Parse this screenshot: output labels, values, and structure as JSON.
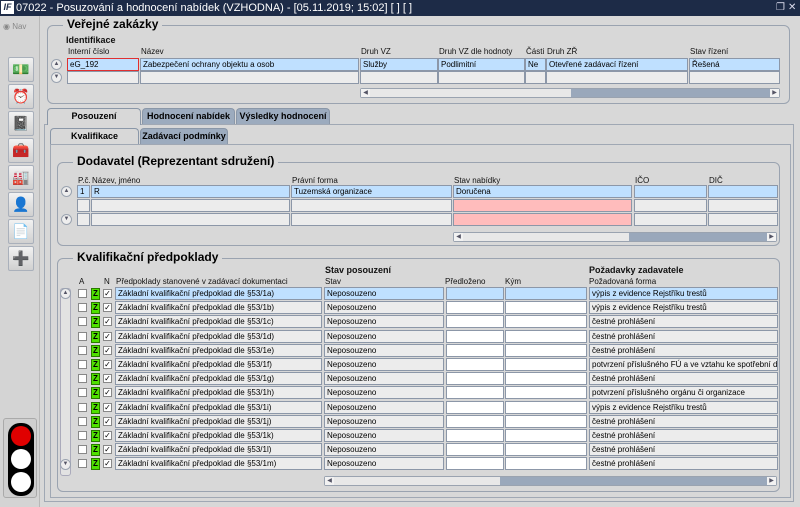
{
  "window": {
    "title": "07022 - Posuzování a hodnocení nabídek (VZHODNA) - [05.11.2019; 15:02]  [ ]  [ ]",
    "logo": "IF",
    "restore_icon": "restore-icon",
    "close_icon": "close-icon"
  },
  "sidebar": {
    "nav_label": "Nav",
    "icons": [
      "money-icon",
      "alarm-clock-icon",
      "notebook-icon",
      "toolbox-icon",
      "factory-icon",
      "person-icon",
      "document-icon",
      "new-document-icon"
    ],
    "traffic_light": {
      "red": "#e00000",
      "active": "red"
    }
  },
  "zakazky": {
    "title": "Veřejné zakázky",
    "section": "Identifikace",
    "columns": [
      "Interní číslo",
      "Název",
      "Druh VZ",
      "Druh VZ dle hodnoty",
      "Části",
      "Druh ZŘ",
      "Stav řízení"
    ],
    "row": [
      "eG_192",
      "Zabezpečení ochrany objektu a osob",
      "Služby",
      "Podlimitní",
      "Ne",
      "Otevřené zadávací řízení",
      "Řešená"
    ]
  },
  "tabs": [
    {
      "label": "Posouzení",
      "active": true
    },
    {
      "label": "Hodnocení nabídek"
    },
    {
      "label": "Výsledky hodnocení"
    }
  ],
  "subtabs": [
    {
      "label": "Kvalifikace",
      "active": true
    },
    {
      "label": "Zadávací podmínky"
    }
  ],
  "dodavatel": {
    "title": "Dodavatel (Reprezentant sdružení)",
    "columns": [
      "P.č.",
      "Název, jméno",
      "Právní forma",
      "Stav nabídky",
      "IČO",
      "DIČ"
    ],
    "rows": [
      [
        "1",
        "R",
        "Tuzemská organizace",
        "Doručena",
        "",
        ""
      ],
      [
        "",
        "",
        "",
        "",
        "",
        ""
      ],
      [
        "",
        "",
        "",
        "",
        "",
        ""
      ]
    ]
  },
  "kvalifikace": {
    "title": "Kvalifikační předpoklady",
    "group_stav": "Stav posouzení",
    "group_pozadavky": "Požadavky zadavatele",
    "columns": {
      "a": "A",
      "n": "N",
      "predpoklady": "Předpoklady stanovené v zadávací dokumentaci",
      "stav": "Stav",
      "predlozeno": "Předloženo",
      "kym": "Kým",
      "forma": "Požadovaná forma"
    },
    "z_label": "Z",
    "z_color": "#4fe000",
    "rows": [
      {
        "a": false,
        "n": true,
        "predpoklad": "Základní kvalifikační předpoklad dle §53/1a)",
        "stav": "Neposouzeno",
        "forma": "výpis z evidence Rejstříku trestů"
      },
      {
        "a": false,
        "n": true,
        "predpoklad": "Základní kvalifikační předpoklad dle §53/1b)",
        "stav": "Neposouzeno",
        "forma": "výpis z evidence Rejstříku trestů"
      },
      {
        "a": false,
        "n": true,
        "predpoklad": "Základní kvalifikační předpoklad dle §53/1c)",
        "stav": "Neposouzeno",
        "forma": "čestné prohlášení"
      },
      {
        "a": false,
        "n": true,
        "predpoklad": "Základní kvalifikační předpoklad dle §53/1d)",
        "stav": "Neposouzeno",
        "forma": "čestné prohlášení"
      },
      {
        "a": false,
        "n": true,
        "predpoklad": "Základní kvalifikační předpoklad dle §53/1e)",
        "stav": "Neposouzeno",
        "forma": "čestné prohlášení"
      },
      {
        "a": false,
        "n": true,
        "predpoklad": "Základní kvalifikační předpoklad dle §53/1f)",
        "stav": "Neposouzeno",
        "forma": "potvrzení příslušného FÚ a ve vztahu ke spotřební d"
      },
      {
        "a": false,
        "n": true,
        "predpoklad": "Základní kvalifikační předpoklad dle §53/1g)",
        "stav": "Neposouzeno",
        "forma": "čestné prohlášení"
      },
      {
        "a": false,
        "n": true,
        "predpoklad": "Základní kvalifikační předpoklad dle §53/1h)",
        "stav": "Neposouzeno",
        "forma": "potvrzení příslušného orgánu či organizace"
      },
      {
        "a": false,
        "n": true,
        "predpoklad": "Základní kvalifikační předpoklad dle §53/1i)",
        "stav": "Neposouzeno",
        "forma": "výpis z evidence Rejstříku trestů"
      },
      {
        "a": false,
        "n": true,
        "predpoklad": "Základní kvalifikační předpoklad dle §53/1j)",
        "stav": "Neposouzeno",
        "forma": "čestné prohlášení"
      },
      {
        "a": false,
        "n": true,
        "predpoklad": "Základní kvalifikační předpoklad dle §53/1k)",
        "stav": "Neposouzeno",
        "forma": "čestné prohlášení"
      },
      {
        "a": false,
        "n": true,
        "predpoklad": "Základní kvalifikační předpoklad dle §53/1l)",
        "stav": "Neposouzeno",
        "forma": "čestné prohlášení"
      },
      {
        "a": false,
        "n": true,
        "predpoklad": "Základní kvalifikační předpoklad dle §53/1m)",
        "stav": "Neposouzeno",
        "forma": "čestné prohlášení"
      }
    ]
  }
}
